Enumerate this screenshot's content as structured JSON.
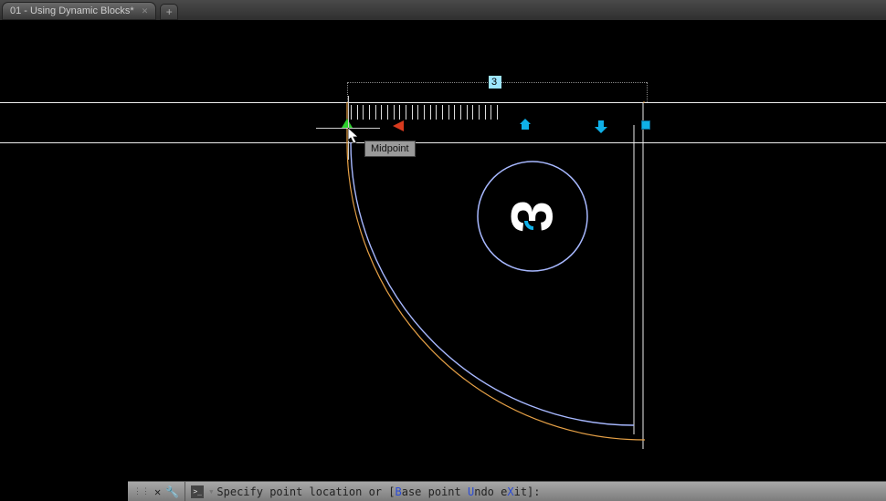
{
  "tabs": {
    "active": {
      "label": "01 - Using Dynamic Blocks*"
    }
  },
  "drawing": {
    "dim_value": "3",
    "block_label": "3",
    "osnap_tooltip": "Midpoint"
  },
  "command": {
    "prompt_prefix": "Specify point location or [",
    "opt1_letter": "B",
    "opt1_rest": "ase point",
    "sep1": " ",
    "opt2_letter": "U",
    "opt2_rest": "ndo",
    "sep2": " e",
    "opt3_letter": "X",
    "opt3_rest": "it",
    "prompt_suffix": "]:"
  }
}
